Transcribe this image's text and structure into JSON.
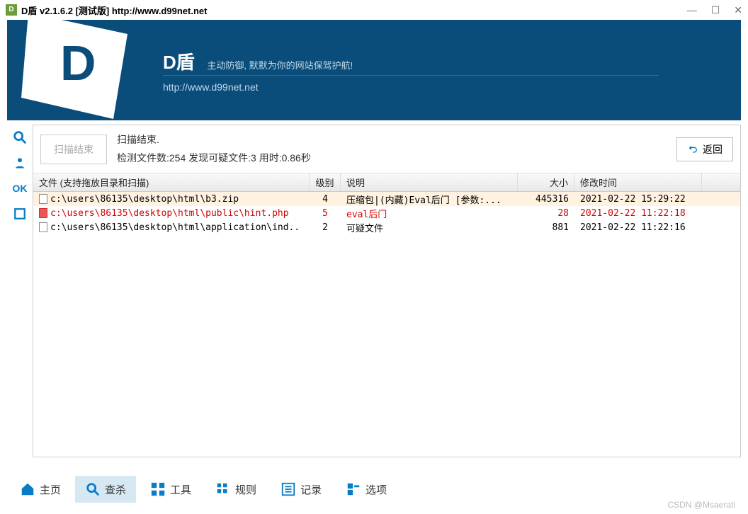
{
  "titlebar": {
    "title": "D盾 v2.1.6.2 [测试版] http://www.d99net.net"
  },
  "banner": {
    "brand": "D盾",
    "slogan": "主动防御, 默默为你的网站保驾护航!",
    "url": "http://www.d99net.net"
  },
  "sidebar": {
    "ok": "OK"
  },
  "topstrip": {
    "scan_btn": "扫描结束",
    "status_line1": "扫描结束.",
    "status_line2": "检测文件数:254 发现可疑文件:3 用时:0.86秒",
    "back": "返回"
  },
  "columns": {
    "file": "文件 (支持拖放目录和扫描)",
    "level": "级别",
    "desc": "说明",
    "size": "大小",
    "time": "修改时间"
  },
  "rows": [
    {
      "file": "c:\\users\\86135\\desktop\\html\\b3.zip",
      "level": "4",
      "desc": "压缩包|(内藏)Eval后门 [参数:...",
      "size": "445316",
      "time": "2021-02-22 15:29:22",
      "variant": "sel"
    },
    {
      "file": "c:\\users\\86135\\desktop\\html\\public\\hint.php",
      "level": "5",
      "desc": "eval后门",
      "size": "28",
      "time": "2021-02-22 11:22:18",
      "variant": "red"
    },
    {
      "file": "c:\\users\\86135\\desktop\\html\\application\\ind..",
      "level": "2",
      "desc": "可疑文件",
      "size": "881",
      "time": "2021-02-22 11:22:16",
      "variant": ""
    }
  ],
  "nav": {
    "home": "主页",
    "scan": "查杀",
    "tools": "工具",
    "rules": "规则",
    "log": "记录",
    "options": "选项"
  },
  "watermark": "CSDN @Msaerati"
}
